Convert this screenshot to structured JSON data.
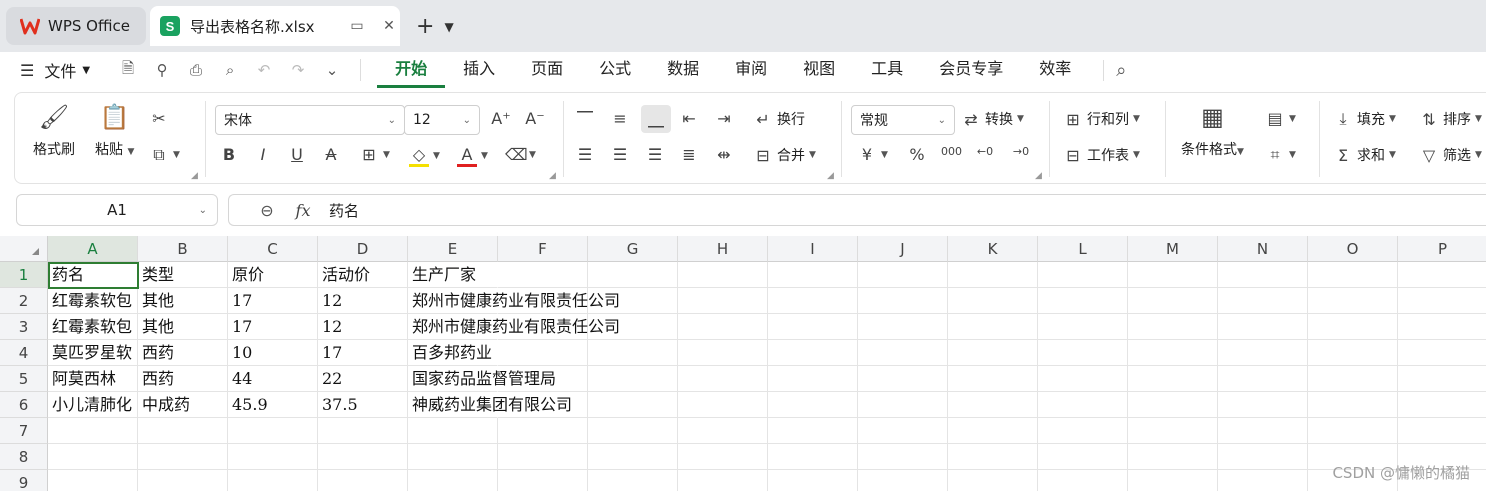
{
  "tabs": {
    "home_label": "WPS Office",
    "doc_title": "导出表格名称.xlsx",
    "doc_icon_letter": "S"
  },
  "menu": {
    "file_label": "文件",
    "items": [
      "开始",
      "插入",
      "页面",
      "公式",
      "数据",
      "审阅",
      "视图",
      "工具",
      "会员专享",
      "效率"
    ],
    "active_index": 0
  },
  "ribbon": {
    "format_painter": "格式刷",
    "paste": "粘贴",
    "font_name": "宋体",
    "font_size": "12",
    "wrap": "换行",
    "merge": "合并",
    "number_format": "常规",
    "convert": "转换",
    "rows_cols": "行和列",
    "worksheet": "工作表",
    "cond_format": "条件格式",
    "fill": "填充",
    "sort": "排序",
    "sum": "求和",
    "filter": "筛选"
  },
  "formula_bar": {
    "name_box": "A1",
    "fx_label": "fx",
    "value": "药名"
  },
  "grid": {
    "columns": [
      "A",
      "B",
      "C",
      "D",
      "E",
      "F",
      "G",
      "H",
      "I",
      "J",
      "K",
      "L",
      "M",
      "N",
      "O",
      "P"
    ],
    "rows": [
      "1",
      "2",
      "3",
      "4",
      "5",
      "6",
      "7",
      "8",
      "9"
    ],
    "cells": [
      [
        "药名",
        "类型",
        "原价",
        "活动价",
        "生产厂家"
      ],
      [
        "红霉素软包",
        "其他",
        "17",
        "12",
        "郑州市健康药业有限责任公司"
      ],
      [
        "红霉素软包",
        "其他",
        "17",
        "12",
        "郑州市健康药业有限责任公司"
      ],
      [
        "莫匹罗星软",
        "西药",
        "10",
        "17",
        "百多邦药业"
      ],
      [
        "阿莫西林",
        "西药",
        "44",
        "22",
        "国家药品监督管理局"
      ],
      [
        "小儿清肺化",
        "中成药",
        "45.9",
        "37.5",
        "神威药业集团有限公司"
      ]
    ]
  },
  "watermark": "CSDN @慵懒的橘猫"
}
